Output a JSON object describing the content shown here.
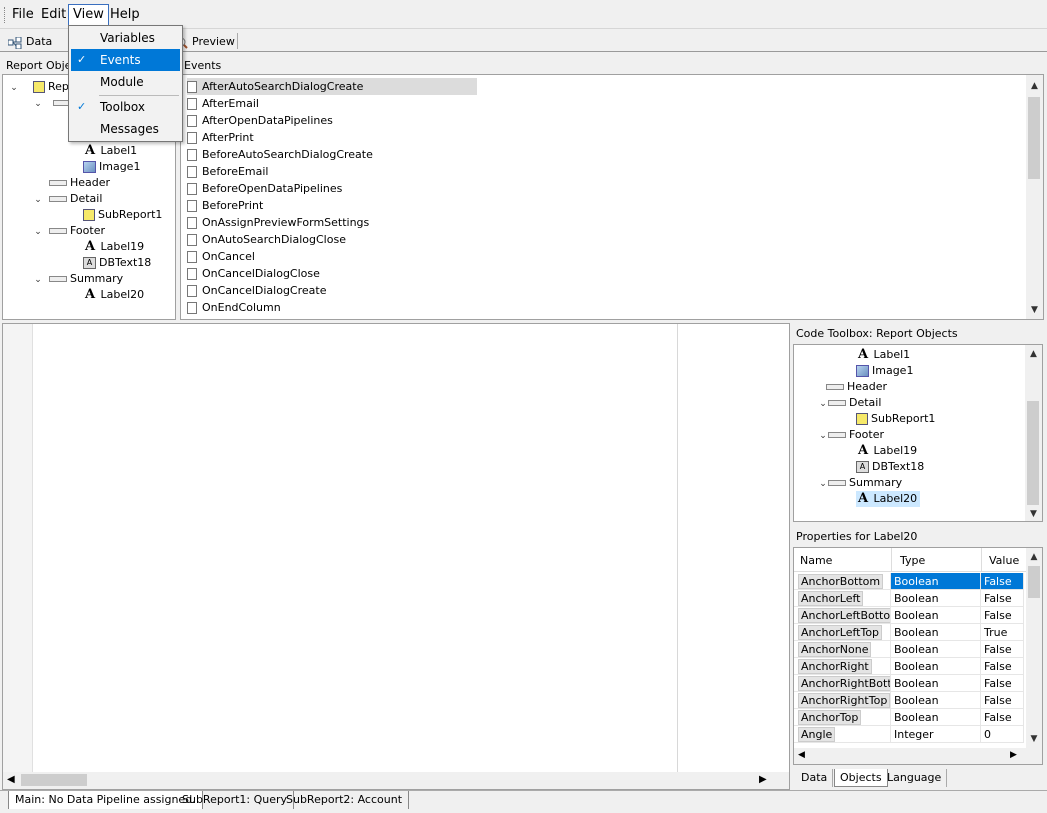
{
  "menubar": {
    "items": [
      "File",
      "Edit",
      "View",
      "Help"
    ]
  },
  "toolbar": {
    "data_label": "Data",
    "preview_label": "Preview"
  },
  "view_menu": {
    "items": [
      {
        "label": "Variables",
        "checked": false
      },
      {
        "label": "Events",
        "checked": true,
        "highlighted": true
      },
      {
        "label": "Module",
        "checked": false
      },
      {
        "label": "Toolbox",
        "checked": true
      },
      {
        "label": "Messages",
        "checked": false
      }
    ]
  },
  "report_objects": {
    "header": "Report Objects",
    "root": "Report",
    "tree": [
      {
        "label": "Label1",
        "icon": "label-a-icon"
      },
      {
        "label": "Image1",
        "icon": "image-icon"
      },
      {
        "label": "Header",
        "icon": "band-icon"
      },
      {
        "label": "Detail",
        "icon": "band-icon"
      },
      {
        "label": "SubReport1",
        "icon": "subreport-icon"
      },
      {
        "label": "Footer",
        "icon": "band-icon"
      },
      {
        "label": "Label19",
        "icon": "label-a-icon"
      },
      {
        "label": "DBText18",
        "icon": "dbtext-icon"
      },
      {
        "label": "Summary",
        "icon": "band-icon"
      },
      {
        "label": "Label20",
        "icon": "label-a-icon"
      }
    ]
  },
  "events": {
    "header": "Events",
    "items": [
      "AfterAutoSearchDialogCreate",
      "AfterEmail",
      "AfterOpenDataPipelines",
      "AfterPrint",
      "BeforeAutoSearchDialogCreate",
      "BeforeEmail",
      "BeforeOpenDataPipelines",
      "BeforePrint",
      "OnAssignPreviewFormSettings",
      "OnAutoSearchDialogClose",
      "OnCancel",
      "OnCancelDialogClose",
      "OnCancelDialogCreate",
      "OnEndColumn"
    ]
  },
  "code_toolbox": {
    "header": "Code Toolbox: Report Objects",
    "tree": [
      {
        "label": "Label1"
      },
      {
        "label": "Image1"
      },
      {
        "label": "Header"
      },
      {
        "label": "Detail"
      },
      {
        "label": "SubReport1"
      },
      {
        "label": "Footer"
      },
      {
        "label": "Label19"
      },
      {
        "label": "DBText18"
      },
      {
        "label": "Summary"
      },
      {
        "label": "Label20"
      }
    ]
  },
  "properties": {
    "header": "Properties for Label20",
    "columns": [
      "Name",
      "Type",
      "Value"
    ],
    "rows": [
      {
        "name": "AnchorBottom",
        "type": "Boolean",
        "value": "False"
      },
      {
        "name": "AnchorLeft",
        "type": "Boolean",
        "value": "False"
      },
      {
        "name": "AnchorLeftBotto",
        "type": "Boolean",
        "value": "False"
      },
      {
        "name": "AnchorLeftTop",
        "type": "Boolean",
        "value": "True"
      },
      {
        "name": "AnchorNone",
        "type": "Boolean",
        "value": "False"
      },
      {
        "name": "AnchorRight",
        "type": "Boolean",
        "value": "False"
      },
      {
        "name": "AnchorRightBott",
        "type": "Boolean",
        "value": "False"
      },
      {
        "name": "AnchorRightTop",
        "type": "Boolean",
        "value": "False"
      },
      {
        "name": "AnchorTop",
        "type": "Boolean",
        "value": "False"
      },
      {
        "name": "Angle",
        "type": "Integer",
        "value": "0"
      }
    ],
    "tabs": [
      "Data",
      "Objects",
      "Language"
    ]
  },
  "status_tabs": [
    "Main: No Data Pipeline assigned.",
    "SubReport1: Query",
    "SubReport2: Account"
  ],
  "colors": {
    "highlight": "#0078d7",
    "selected_row": "#dcdcdc",
    "selected_tree": "#cce8ff"
  }
}
